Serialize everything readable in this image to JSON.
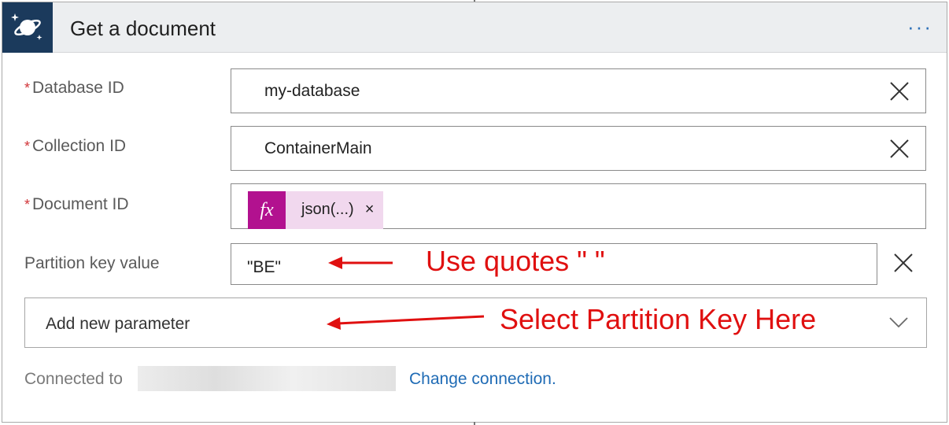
{
  "header": {
    "title": "Get a document",
    "more_label": "···",
    "icon": "cosmos-db-planet-icon"
  },
  "fields": {
    "database": {
      "label": "Database ID",
      "required": true,
      "value": "my-database"
    },
    "collection": {
      "label": "Collection ID",
      "required": true,
      "value": "ContainerMain"
    },
    "document": {
      "label": "Document ID",
      "required": true,
      "token_icon": "fx",
      "token_text": "json(...)",
      "token_remove": "×"
    },
    "partition": {
      "label": "Partition key value",
      "required": false,
      "value": "\"BE\""
    }
  },
  "required_mark": "*",
  "add_parameter": {
    "label": "Add new parameter"
  },
  "connection": {
    "prefix": "Connected to",
    "link": "Change connection."
  },
  "annotations": {
    "quotes": "Use quotes \" \"",
    "partition": "Select Partition Key Here",
    "color": "#e01010"
  }
}
